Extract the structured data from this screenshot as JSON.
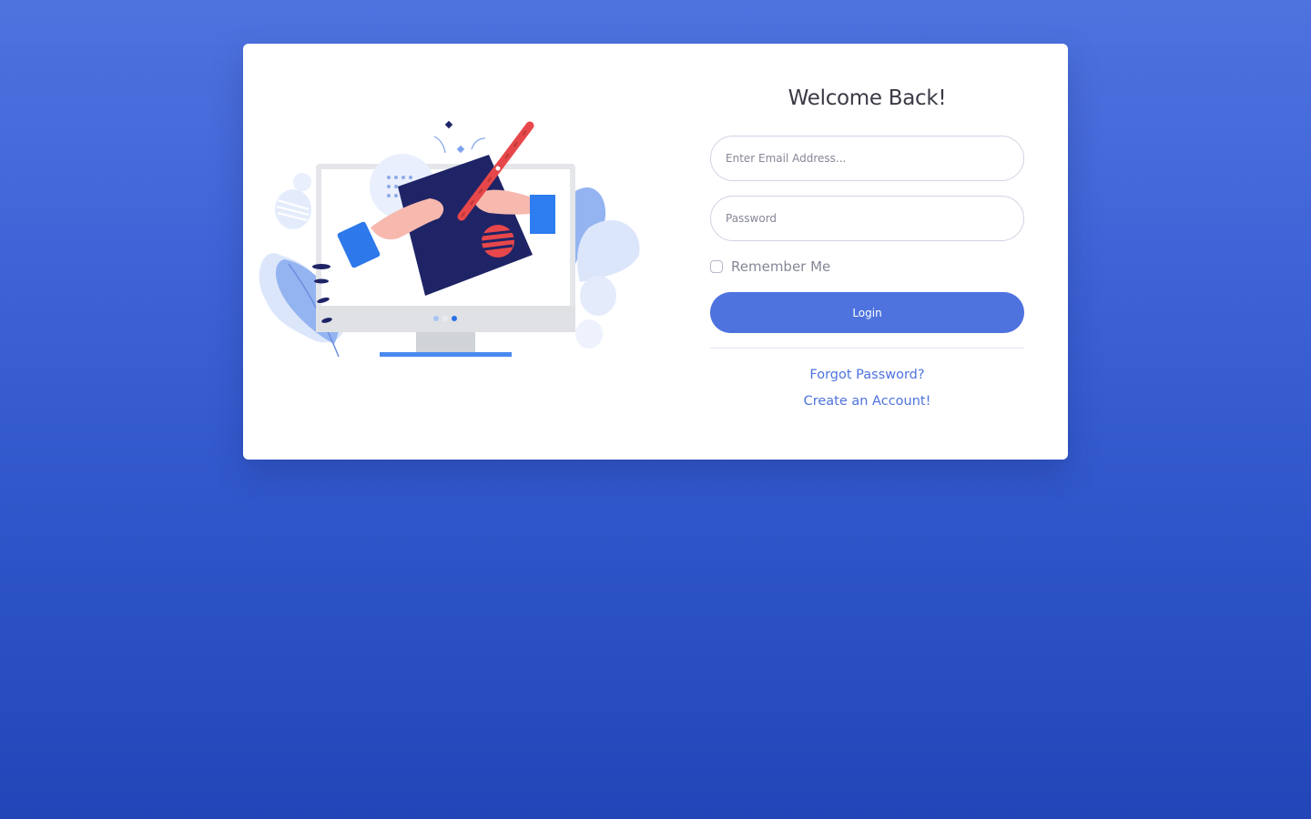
{
  "login": {
    "title": "Welcome Back!",
    "email_placeholder": "Enter Email Address...",
    "password_placeholder": "Password",
    "remember_label": "Remember Me",
    "remember_checked": false,
    "login_label": "Login",
    "forgot_link": "Forgot Password?",
    "create_link": "Create an Account!"
  },
  "illustration": {
    "icon": "computer-drawing-illustration"
  },
  "colors": {
    "accent": "#4e73df",
    "text_dark": "#3a3b45",
    "text_muted": "#858796",
    "card_bg": "#ffffff"
  }
}
